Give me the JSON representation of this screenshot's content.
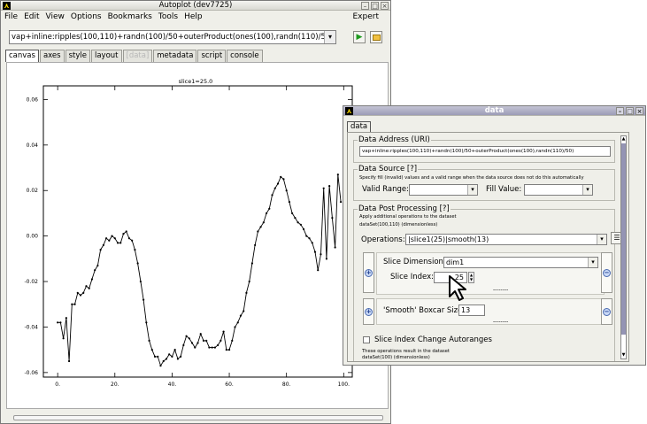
{
  "main_window": {
    "title": "Autoplot (dev7725)",
    "menu": [
      "File",
      "Edit",
      "View",
      "Options",
      "Bookmarks",
      "Tools",
      "Help"
    ],
    "expert_label": "Expert",
    "uri": "vap+inline:ripples(100,110)+randn(100)/50+outerProduct(ones(100),randn(110)/50)",
    "go_icon": "play-icon",
    "browse_icon": "folder-icon",
    "tabs": [
      "canvas",
      "axes",
      "style",
      "layout",
      "[data]",
      "metadata",
      "script",
      "console"
    ],
    "selected_tab": "canvas"
  },
  "chart_data": {
    "type": "line",
    "title": "slice1=25.0",
    "xlabel": "",
    "ylabel": "",
    "xlim": [
      -5,
      103
    ],
    "ylim": [
      -0.062,
      0.066
    ],
    "xticks": [
      "0.",
      "20.",
      "40.",
      "60.",
      "80.",
      "100."
    ],
    "xtick_values": [
      0,
      20,
      40,
      60,
      80,
      100
    ],
    "yticks": [
      "0.06",
      "0.04",
      "0.02",
      "0.00",
      "-0.02",
      "-0.04",
      "-0.06"
    ],
    "ytick_values": [
      0.06,
      0.04,
      0.02,
      0.0,
      -0.02,
      -0.04,
      -0.06
    ],
    "grid": false,
    "x": [
      0,
      1,
      2,
      3,
      4,
      5,
      6,
      7,
      8,
      9,
      10,
      11,
      12,
      13,
      14,
      15,
      16,
      17,
      18,
      19,
      20,
      21,
      22,
      23,
      24,
      25,
      26,
      27,
      28,
      29,
      30,
      31,
      32,
      33,
      34,
      35,
      36,
      37,
      38,
      39,
      40,
      41,
      42,
      43,
      44,
      45,
      46,
      47,
      48,
      49,
      50,
      51,
      52,
      53,
      54,
      55,
      56,
      57,
      58,
      59,
      60,
      61,
      62,
      63,
      64,
      65,
      66,
      67,
      68,
      69,
      70,
      71,
      72,
      73,
      74,
      75,
      76,
      77,
      78,
      79,
      80,
      81,
      82,
      83,
      84,
      85,
      86,
      87,
      88,
      89,
      90,
      91,
      92,
      93,
      94,
      95,
      96,
      97,
      98,
      99
    ],
    "values": [
      -0.038,
      -0.038,
      -0.045,
      -0.036,
      -0.055,
      -0.03,
      -0.03,
      -0.025,
      -0.026,
      -0.025,
      -0.022,
      -0.023,
      -0.019,
      -0.015,
      -0.013,
      -0.006,
      -0.004,
      -0.001,
      -0.002,
      0.0,
      -0.001,
      -0.003,
      -0.003,
      0.001,
      0.002,
      -0.001,
      -0.002,
      -0.006,
      -0.012,
      -0.02,
      -0.028,
      -0.038,
      -0.046,
      -0.05,
      -0.053,
      -0.053,
      -0.057,
      -0.055,
      -0.054,
      -0.052,
      -0.053,
      -0.05,
      -0.054,
      -0.053,
      -0.048,
      -0.044,
      -0.045,
      -0.047,
      -0.049,
      -0.047,
      -0.043,
      -0.046,
      -0.046,
      -0.049,
      -0.049,
      -0.049,
      -0.048,
      -0.046,
      -0.042,
      -0.05,
      -0.05,
      -0.046,
      -0.04,
      -0.038,
      -0.035,
      -0.033,
      -0.025,
      -0.02,
      -0.012,
      -0.004,
      0.002,
      0.004,
      0.006,
      0.01,
      0.012,
      0.018,
      0.021,
      0.023,
      0.026,
      0.025,
      0.02,
      0.015,
      0.01,
      0.008,
      0.006,
      0.005,
      0.003,
      0.0,
      -0.001,
      -0.003,
      -0.007,
      -0.015,
      -0.008,
      0.021,
      -0.01,
      0.022,
      0.008,
      -0.005,
      0.027,
      0.015
    ]
  },
  "data_dialog": {
    "title": "data",
    "tab": "data",
    "address_group": "Data Address (URI)",
    "address_value": "vap+inline:ripples(100,110)+randn(100)/50+outerProduct(ones(100),randn(110)/50)",
    "source_group": "Data Source [?]",
    "source_help": "Specify fill (invalid) values and a valid range when the data source does not do this automatically",
    "valid_range_label": "Valid Range:",
    "valid_range_value": "",
    "fill_value_label": "Fill Value:",
    "fill_value_value": "",
    "post_group": "Data Post Processing [?]",
    "post_help": "Apply additional operations to the dataset",
    "post_dataset": "dataSet(100,110) (dimensionless)",
    "operations_label": "Operations:",
    "operations_value": "|slice1(25)|smooth(13)",
    "slice_dimension_label": "Slice Dimension:",
    "slice_dimension_value": "dim1",
    "slice_index_label": "Slice Index:",
    "slice_index_value": "25",
    "boxcar_label": "'Smooth' Boxcar Size:",
    "boxcar_value": "13",
    "divider": "--------",
    "autoranges_label": "Slice Index Change Autoranges",
    "result_line1": "These operations result in the dataset",
    "result_line2": "dataSet(100) (dimensionless)"
  }
}
